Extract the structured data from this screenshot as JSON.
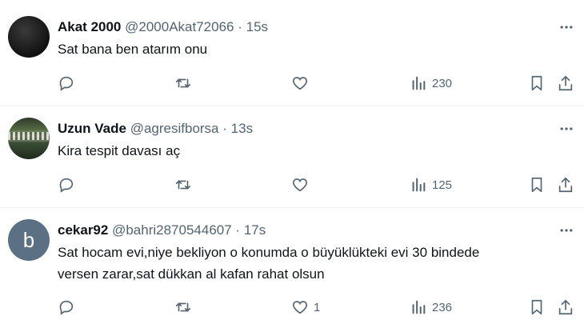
{
  "tweets": [
    {
      "name": "Akat 2000",
      "handle": "@2000Akat72066",
      "separator": "·",
      "time": "15s",
      "avatar_letter": "",
      "text_lines": [
        "Sat bana ben atarım onu"
      ],
      "likes": "",
      "views": "230"
    },
    {
      "name": "Uzun Vade",
      "handle": "@agresifborsa",
      "separator": "·",
      "time": "13s",
      "avatar_letter": "",
      "text_lines": [
        "Kira tespit davası aç"
      ],
      "likes": "",
      "views": "125"
    },
    {
      "name": "cekar92",
      "handle": "@bahri2870544607",
      "separator": "·",
      "time": "17s",
      "avatar_letter": "b",
      "text_lines": [
        "Sat hocam evi,niye bekliyon o konumda o büyüklükteki evi 30 bindede",
        "versen zarar,sat dükkan al kafan rahat olsun"
      ],
      "likes": "1",
      "views": "236"
    }
  ],
  "colors": {
    "text": "#0f1419",
    "muted": "#536471",
    "divider": "#eff3f4",
    "avatar_letter_bg": "#5b7083"
  },
  "icons": [
    "more-icon",
    "reply-icon",
    "retweet-icon",
    "like-icon",
    "views-icon",
    "bookmark-icon",
    "share-icon"
  ]
}
